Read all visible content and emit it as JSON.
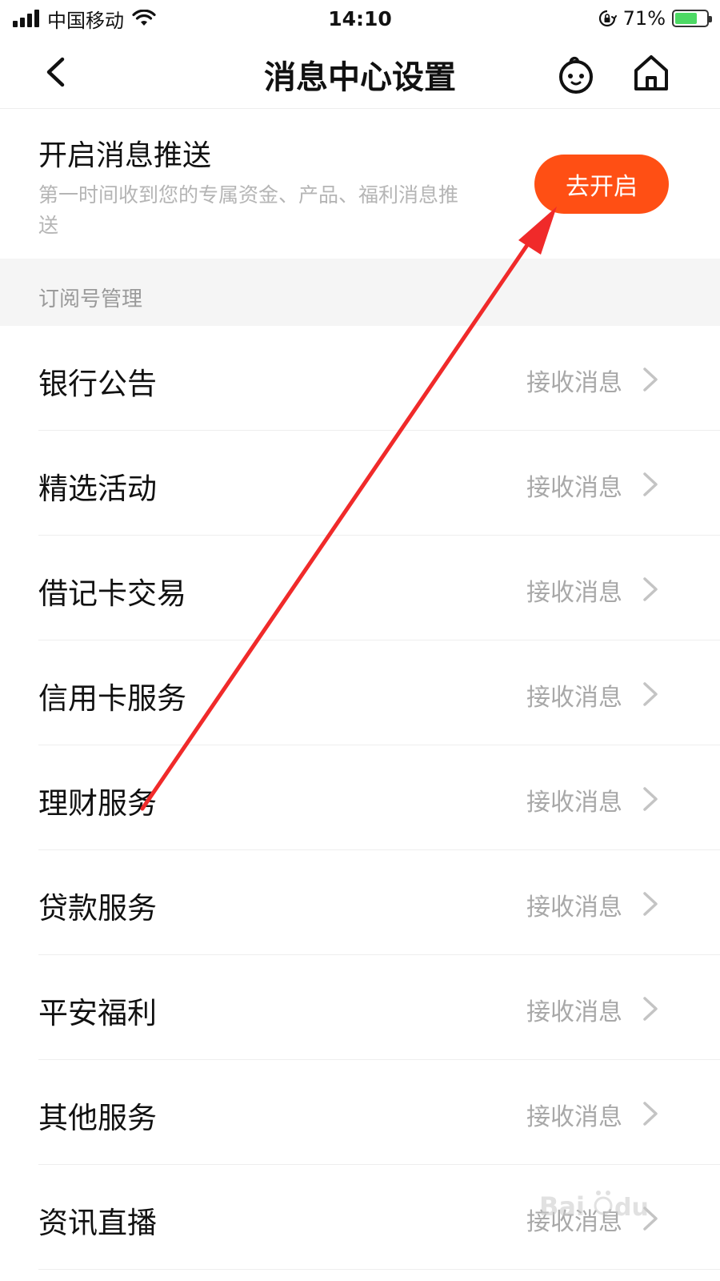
{
  "status_bar": {
    "carrier": "中国移动",
    "time": "14:10",
    "battery_percent": "71%",
    "battery_level": 0.71
  },
  "nav": {
    "title": "消息中心设置",
    "icons": [
      "back-icon",
      "robot-icon",
      "home-icon"
    ]
  },
  "push": {
    "title": "开启消息推送",
    "description": "第一时间收到您的专属资金、产品、福利消息推送",
    "button_label": "去开启"
  },
  "subscriptions": {
    "header": "订阅号管理",
    "items": [
      {
        "name": "银行公告",
        "status": "接收消息"
      },
      {
        "name": "精选活动",
        "status": "接收消息"
      },
      {
        "name": "借记卡交易",
        "status": "接收消息"
      },
      {
        "name": "信用卡服务",
        "status": "接收消息"
      },
      {
        "name": "理财服务",
        "status": "接收消息"
      },
      {
        "name": "贷款服务",
        "status": "接收消息"
      },
      {
        "name": "平安福利",
        "status": "接收消息"
      },
      {
        "name": "其他服务",
        "status": "接收消息"
      },
      {
        "name": "资讯直播",
        "status": "接收消息"
      }
    ]
  },
  "colors": {
    "accent": "#ff4f14",
    "annotation": "#f02a2a",
    "muted_text": "#a8a8a8",
    "section_bg": "#f5f5f5"
  }
}
